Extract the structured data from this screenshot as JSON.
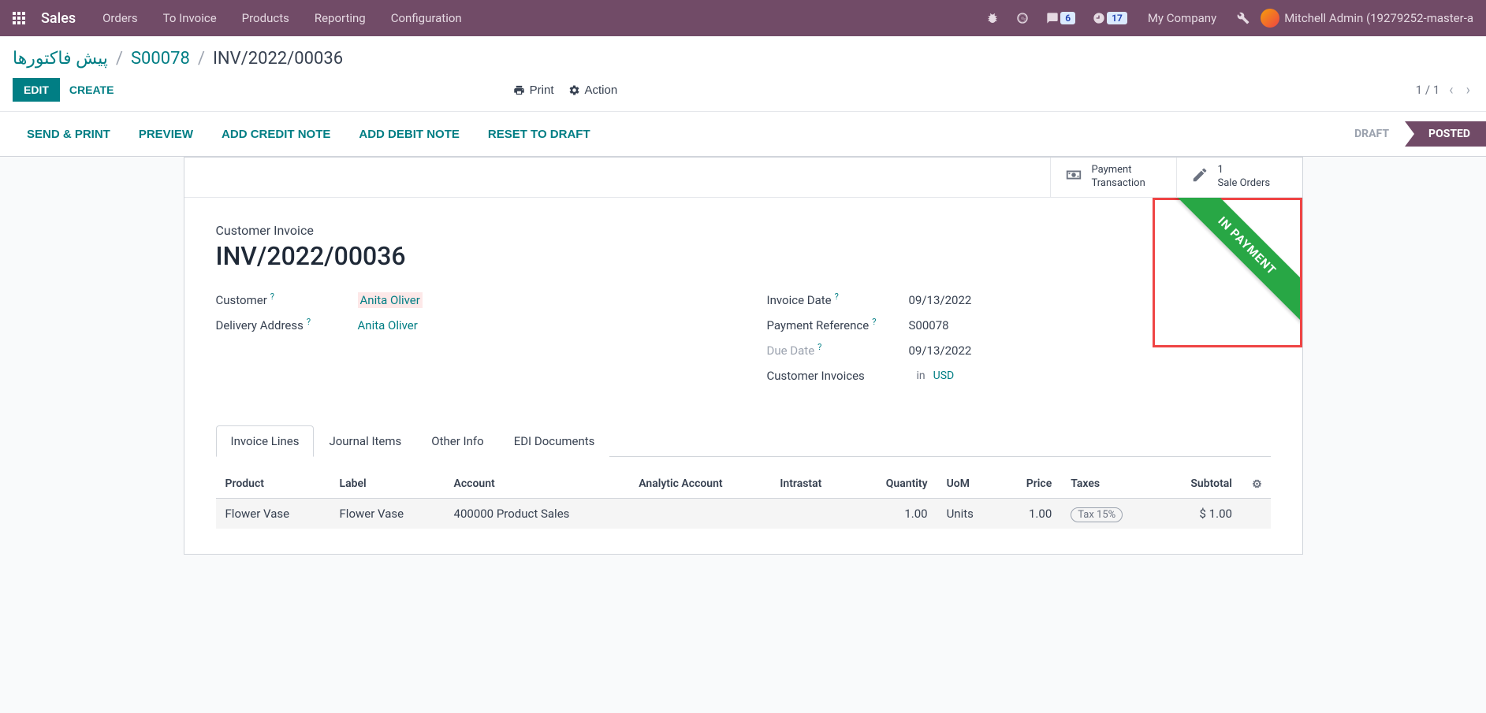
{
  "topbar": {
    "brand": "Sales",
    "nav": [
      "Orders",
      "To Invoice",
      "Products",
      "Reporting",
      "Configuration"
    ],
    "messages_count": "6",
    "activities_count": "17",
    "company": "My Company",
    "user": "Mitchell Admin (19279252-master-a"
  },
  "breadcrumb": {
    "root": "پیش فاکتورها",
    "parent": "S00078",
    "current": "INV/2022/00036"
  },
  "buttons": {
    "edit": "EDIT",
    "create": "CREATE",
    "print": "Print",
    "action": "Action"
  },
  "pager": {
    "text": "1 / 1"
  },
  "status_actions": [
    "SEND & PRINT",
    "PREVIEW",
    "ADD CREDIT NOTE",
    "ADD DEBIT NOTE",
    "RESET TO DRAFT"
  ],
  "stages": {
    "draft": "DRAFT",
    "posted": "POSTED"
  },
  "stat_buttons": {
    "payment": {
      "line1": "Payment",
      "line2": "Transaction"
    },
    "sale": {
      "count": "1",
      "label": "Sale Orders"
    }
  },
  "ribbon": "IN PAYMENT",
  "doc": {
    "type": "Customer Invoice",
    "name": "INV/2022/00036"
  },
  "fields": {
    "customer_label": "Customer",
    "customer_value": "Anita Oliver",
    "delivery_label": "Delivery Address",
    "delivery_value": "Anita Oliver",
    "invoice_date_label": "Invoice Date",
    "invoice_date_value": "09/13/2022",
    "payment_ref_label": "Payment Reference",
    "payment_ref_value": "S00078",
    "due_date_label": "Due Date",
    "due_date_value": "09/13/2022",
    "journal_label": "Customer Invoices",
    "journal_in": "in",
    "journal_currency": "USD"
  },
  "tabs": [
    "Invoice Lines",
    "Journal Items",
    "Other Info",
    "EDI Documents"
  ],
  "table": {
    "headers": {
      "product": "Product",
      "label": "Label",
      "account": "Account",
      "analytic": "Analytic Account",
      "intrastat": "Intrastat",
      "quantity": "Quantity",
      "uom": "UoM",
      "price": "Price",
      "taxes": "Taxes",
      "subtotal": "Subtotal"
    },
    "rows": [
      {
        "product": "Flower Vase",
        "label": "Flower Vase",
        "account": "400000 Product Sales",
        "analytic": "",
        "intrastat": "",
        "quantity": "1.00",
        "uom": "Units",
        "price": "1.00",
        "taxes": "Tax 15%",
        "subtotal": "$ 1.00"
      }
    ]
  }
}
